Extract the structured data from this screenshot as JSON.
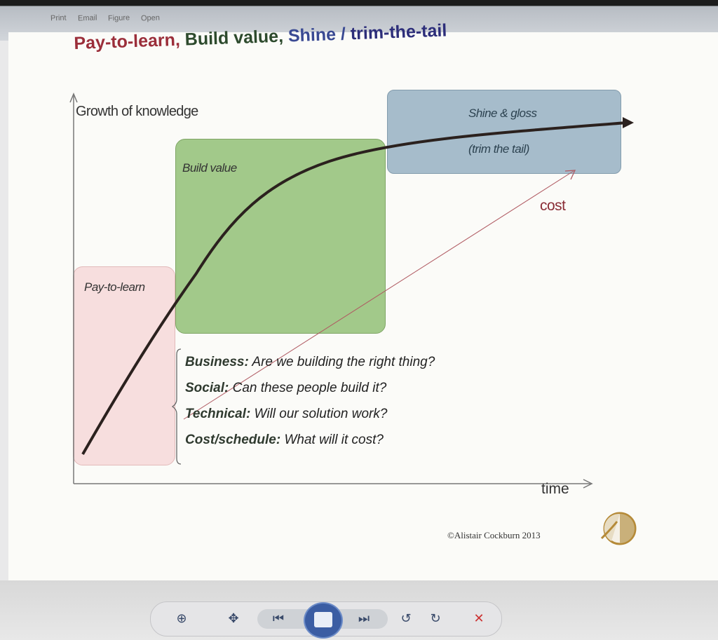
{
  "window": {
    "menu": [
      "Print",
      "Email",
      "Figure",
      "Open"
    ]
  },
  "slide": {
    "title": {
      "part1": "Pay-to-learn,",
      "part2": "Build value,",
      "part3": "Shine /",
      "part4": "trim-the-tail"
    },
    "y_axis_label": "Growth of knowledge",
    "x_axis_label": "time",
    "regions": {
      "pay_to_learn": "Pay-to-learn",
      "build_value": "Build value",
      "shine_line1": "Shine & gloss",
      "shine_line2": "(trim the tail)"
    },
    "cost_label": "cost",
    "questions": [
      {
        "key": "Business:",
        "text": "Are we building the right thing?"
      },
      {
        "key": "Social:",
        "text": "Can these people build it?"
      },
      {
        "key": "Technical:",
        "text": "Will our solution work?"
      },
      {
        "key": "Cost/schedule:",
        "text": "What will it cost?"
      }
    ],
    "copyright": "©Alistair Cockburn 2013"
  },
  "colors": {
    "pay_region": "#f7dede",
    "build_region": "#a2c98a",
    "shine_region": "#a6bccb",
    "curve": "#2b211e",
    "cost_line": "#b05a62"
  },
  "toolbar": {
    "icons": [
      "zoom-icon",
      "move-icon",
      "previous-slide-icon",
      "home-icon",
      "next-slide-icon",
      "rotate-left-icon",
      "rotate-right-icon",
      "close-icon"
    ]
  }
}
